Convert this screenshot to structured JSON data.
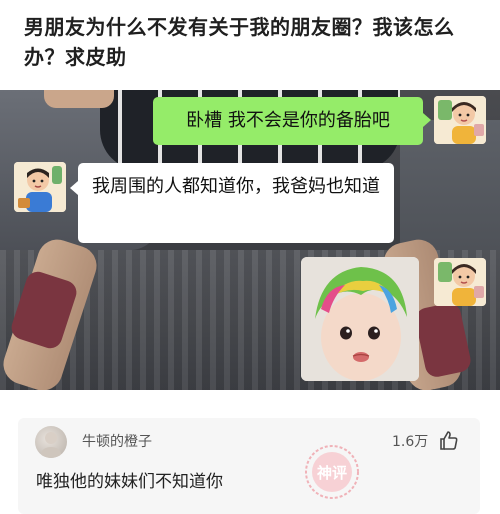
{
  "post": {
    "title": "男朋友为什么不发有关于我的朋友圈？我该怎么办？求皮助"
  },
  "chat": {
    "messages": [
      {
        "side": "right",
        "text": "卧槽 我不会是你的备胎吧"
      },
      {
        "side": "left",
        "text": "我周围的人都知道你，我爸妈也知道"
      }
    ],
    "sticker_icon": "crying-child-sticker",
    "colors": {
      "self_bubble": "#95ec69",
      "other_bubble": "#ffffff"
    }
  },
  "comment": {
    "username": "牛顿的橙子",
    "likes": "1.6万",
    "like_icon": "thumbs-up-icon",
    "stamp_text": "神评",
    "text": "唯独他的妹妹们不知道你"
  }
}
